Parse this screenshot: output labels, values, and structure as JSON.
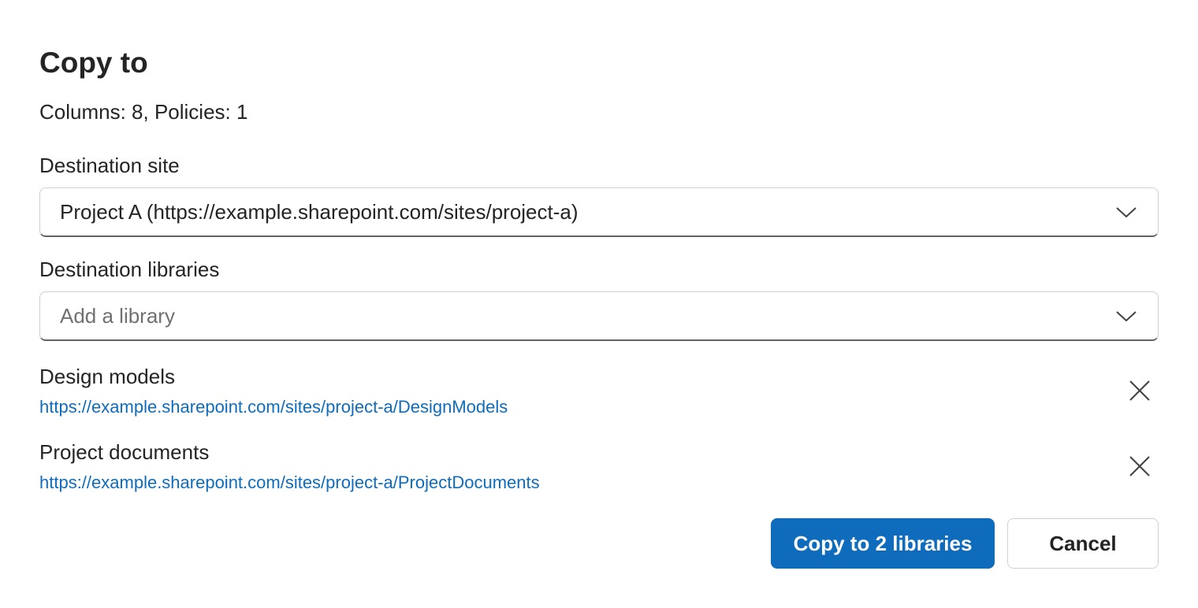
{
  "dialog": {
    "title": "Copy to",
    "summary": "Columns: 8, Policies: 1"
  },
  "destination_site": {
    "label": "Destination site",
    "value": "Project A (https://example.sharepoint.com/sites/project-a)",
    "icon": "chevron-down-icon"
  },
  "destination_libraries": {
    "label": "Destination libraries",
    "placeholder": "Add a library",
    "icon": "chevron-down-icon",
    "selected": [
      {
        "name": "Design models",
        "url": "https://example.sharepoint.com/sites/project-a/DesignModels",
        "remove_icon": "close-icon"
      },
      {
        "name": "Project documents",
        "url": "https://example.sharepoint.com/sites/project-a/ProjectDocuments",
        "remove_icon": "close-icon"
      }
    ]
  },
  "actions": {
    "primary_label": "Copy to 2 libraries",
    "cancel_label": "Cancel"
  },
  "colors": {
    "accent": "#0f6cbd",
    "text": "#242424",
    "placeholder": "#707070",
    "border": "#d1d1d1"
  }
}
